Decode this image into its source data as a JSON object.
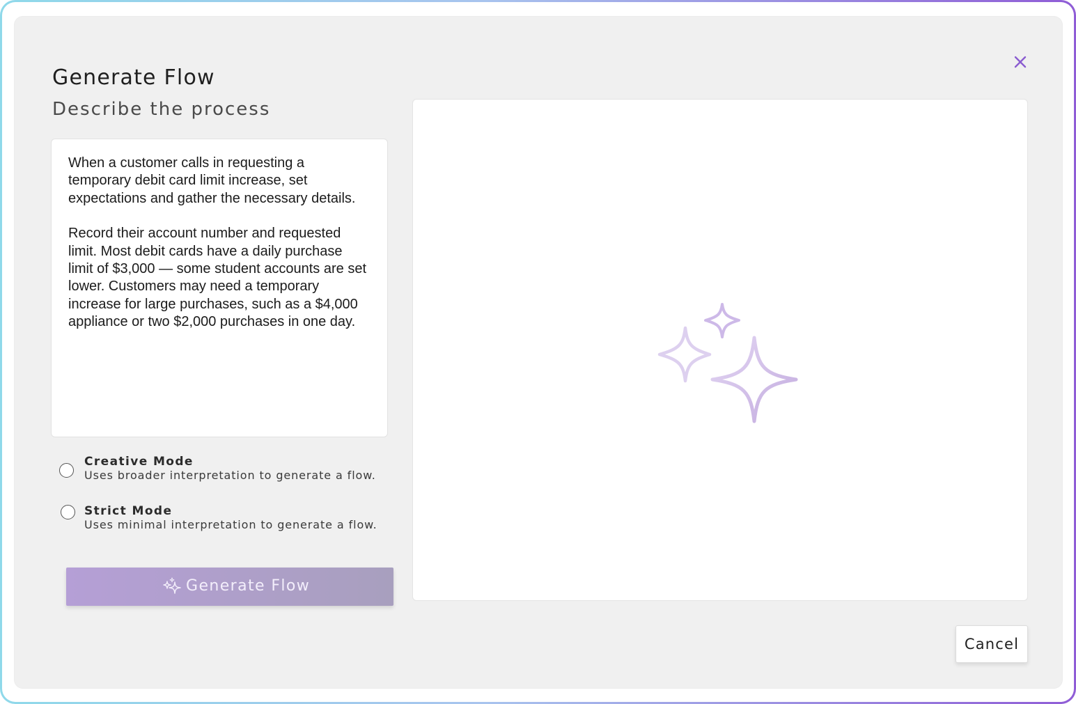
{
  "dialog": {
    "title": "Generate Flow",
    "subtitle": "Describe the process",
    "description_paragraphs": [
      "When a customer calls in requesting a temporary debit card limit increase, set expectations and gather the necessary details.",
      "Record their account number and requested limit. Most debit cards have a daily purchase limit of $3,000 — some student accounts are set lower. Customers may need a temporary increase for large purchases, such as a $4,000 appliance or two $2,000 purchases in one day."
    ],
    "modes": [
      {
        "label": "Creative Mode",
        "hint": "Uses broader interpretation to generate a flow.",
        "selected": false
      },
      {
        "label": "Strict Mode",
        "hint": "Uses minimal interpretation to generate a flow.",
        "selected": false
      }
    ],
    "generate_label": "Generate Flow",
    "cancel_label": "Cancel"
  },
  "icons": {
    "close": "close-icon",
    "generate": "sparkles-icon",
    "preview": "sparkles-icon"
  },
  "colors": {
    "accent": "#8a5cd0",
    "sparkle_stroke": "#c8b6e6",
    "generate_button_start": "#b59fd6",
    "generate_button_end": "#a89fbe",
    "dialog_background": "#f0f0f0"
  }
}
